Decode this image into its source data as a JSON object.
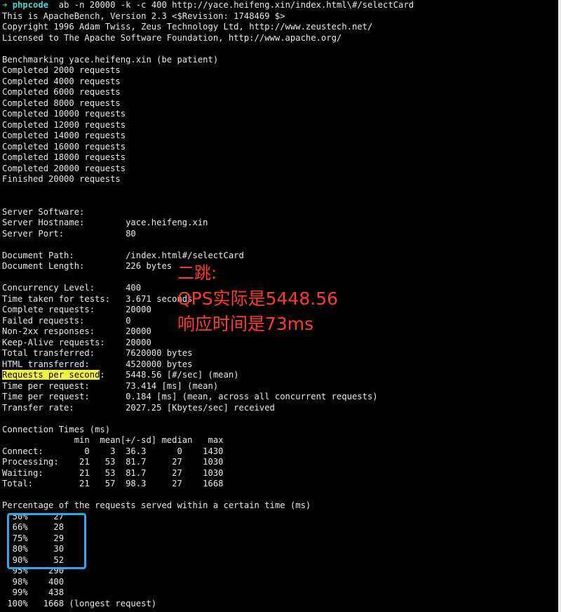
{
  "prompt": {
    "arrow": "➜",
    "dir": "phpcode",
    "command": "ab -n 20000 -k -c 400 http://yace.heifeng.xin/index.html\\#/selectCard"
  },
  "header": [
    "This is ApacheBench, Version 2.3 <$Revision: 1748469 $>",
    "Copyright 1996 Adam Twiss, Zeus Technology Ltd, http://www.zeustech.net/",
    "Licensed to The Apache Software Foundation, http://www.apache.org/"
  ],
  "progress": [
    "Benchmarking yace.heifeng.xin (be patient)",
    "Completed 2000 requests",
    "Completed 4000 requests",
    "Completed 6000 requests",
    "Completed 8000 requests",
    "Completed 10000 requests",
    "Completed 12000 requests",
    "Completed 14000 requests",
    "Completed 16000 requests",
    "Completed 18000 requests",
    "Completed 20000 requests",
    "Finished 20000 requests"
  ],
  "server": [
    "Server Software:",
    "Server Hostname:        yace.heifeng.xin",
    "Server Port:            80"
  ],
  "document": [
    "Document Path:          /index.html#/selectCard",
    "Document Length:        226 bytes"
  ],
  "stats": [
    "Concurrency Level:      400",
    "Time taken for tests:   3.671 seconds",
    "Complete requests:      20000",
    "Failed requests:        0",
    "Non-2xx responses:      20000",
    "Keep-Alive requests:    20000",
    "Total transferred:      7620000 bytes",
    "HTML transferred:       4520000 bytes"
  ],
  "rps": {
    "label": "Requests per second",
    "rest": ":    5448.56 [#/sec] (mean)"
  },
  "stats2": [
    "Time per request:       73.414 [ms] (mean)",
    "Time per request:       0.184 [ms] (mean, across all concurrent requests)",
    "Transfer rate:          2027.25 [Kbytes/sec] received"
  ],
  "connection_times": [
    "Connection Times (ms)",
    "              min  mean[+/-sd] median   max",
    "Connect:        0    3  36.3      0    1430",
    "Processing:    21   53  81.7     27    1030",
    "Waiting:       21   53  81.7     27    1030",
    "Total:         21   57  98.3     27    1668"
  ],
  "percentage": [
    "Percentage of the requests served within a certain time (ms)",
    "  50%     27",
    "  66%     28",
    "  75%     29",
    "  80%     30",
    "  90%     52",
    "  95%    290",
    "  98%    400",
    "  99%    438",
    " 100%   1668 (longest request)"
  ],
  "annotation": [
    "二跳:",
    "QPS实际是5448.56",
    "响应时间是73ms"
  ],
  "colors": {
    "background": "#000000",
    "text": "#e8e8e8",
    "prompt_arrow": "#4cd35a",
    "prompt_dir": "#4cd3d3",
    "highlight": "#f4f43a",
    "annotation": "#ff3b2a",
    "box": "#2aa8f0"
  }
}
